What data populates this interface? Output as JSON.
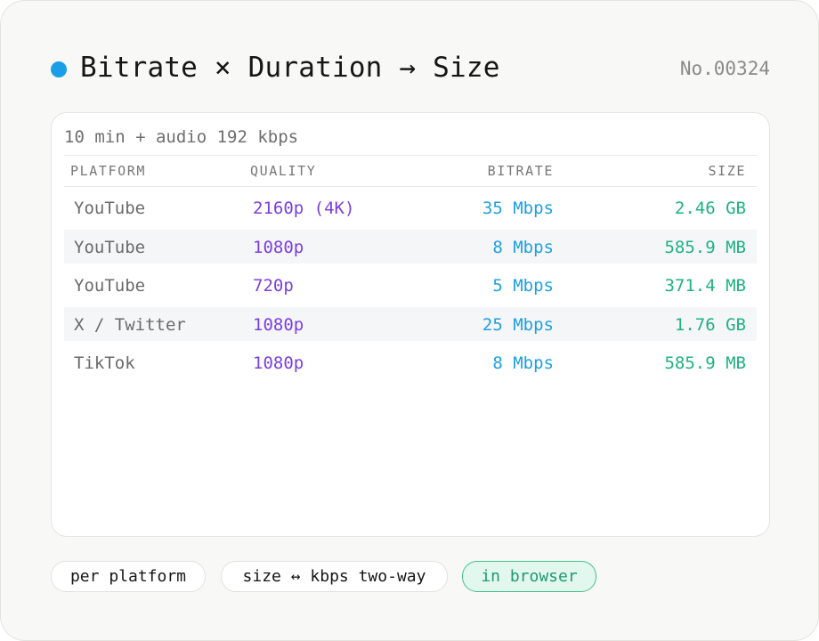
{
  "header": {
    "title": "Bitrate × Duration → Size",
    "serial": "No.00324",
    "dot_color": "#1a9ee8"
  },
  "panel": {
    "label": "10 min + audio 192 kbps",
    "columns": [
      "PLATFORM",
      "QUALITY",
      "BITRATE",
      "SIZE"
    ],
    "rows": [
      {
        "platform": "YouTube",
        "quality": "2160p (4K)",
        "bitrate": "35 Mbps",
        "size": "2.46 GB"
      },
      {
        "platform": "YouTube",
        "quality": "1080p",
        "bitrate": "8 Mbps",
        "size": "585.9 MB"
      },
      {
        "platform": "YouTube",
        "quality": "720p",
        "bitrate": "5 Mbps",
        "size": "371.4 MB"
      },
      {
        "platform": "X / Twitter",
        "quality": "1080p",
        "bitrate": "25 Mbps",
        "size": "1.76 GB"
      },
      {
        "platform": "TikTok",
        "quality": "1080p",
        "bitrate": "8 Mbps",
        "size": "585.9 MB"
      }
    ]
  },
  "tags": [
    "per platform",
    "size ↔ kbps two-way",
    "in browser"
  ],
  "colors": {
    "accent_dot": "#1a9ee8",
    "quality": "#7b3fe0",
    "bitrate": "#1ea0e0",
    "size": "#1fb27f"
  }
}
